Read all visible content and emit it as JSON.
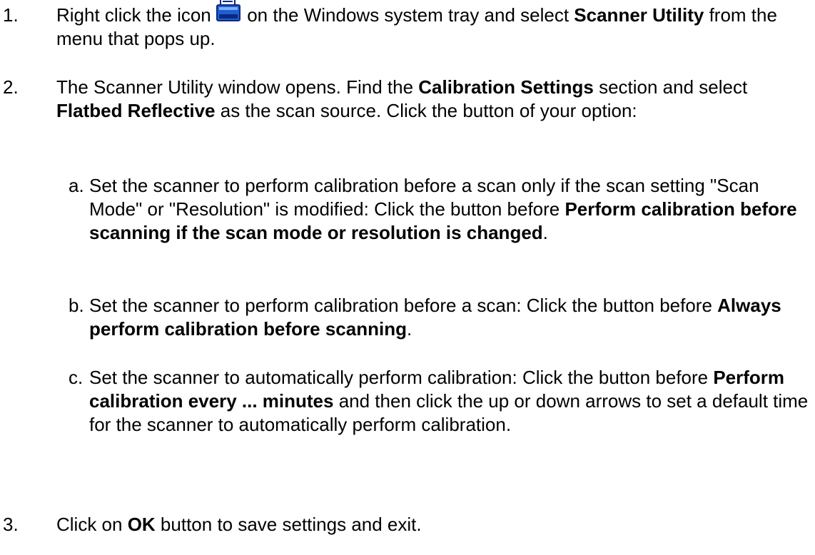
{
  "steps": [
    {
      "number": "1.",
      "text_1": "Right click the icon ",
      "icon": "scanner-tray-icon",
      "text_2": " on the Windows system tray and select ",
      "bold_1": "Scanner Utility",
      "text_3": " from the menu that pops up."
    },
    {
      "number": "2.",
      "text_1": "The Scanner Utility window opens.  Find the ",
      "bold_1": "Calibration Settings",
      "text_2": " section and select ",
      "bold_2": "Flatbed Reflective",
      "text_3": " as the scan source. Click the button of your option:"
    },
    {
      "number": "3.",
      "text_1": "Click on ",
      "bold_1": "OK",
      "text_2": " button to save settings and exit."
    }
  ],
  "options": [
    {
      "letter": "a.",
      "text_1": "Set the scanner to perform calibration before a scan only if the scan setting \"Scan Mode\" or \"Resolution\" is modified: Click the button before ",
      "bold_1": "Perform calibration before scanning if the scan mode or resolution is changed",
      "text_2": "."
    },
    {
      "letter": "b.",
      "text_1": "Set the scanner to perform calibration before a scan: Click the button before ",
      "bold_1": "Always perform calibration before scanning",
      "text_2": "."
    },
    {
      "letter": "c.",
      "text_1": "Set the scanner to automatically perform calibration: Click the button before ",
      "bold_1": "Perform calibration every ... minutes",
      "text_2": " and then click the up or down arrows to set a default time for the scanner to automatically perform calibration."
    }
  ],
  "colors": {
    "text": "#000000",
    "background": "#ffffff",
    "icon_blue": "#1f5fd0",
    "icon_dark": "#0a2a80"
  }
}
